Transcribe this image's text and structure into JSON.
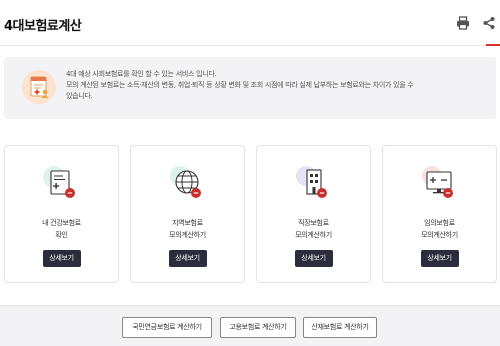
{
  "header": {
    "title": "4대보험료계산",
    "print_icon": "print-icon",
    "share_icon": "share-icon",
    "accent_color": "#d6332f"
  },
  "notice": {
    "icon": "document-person-icon",
    "lines": [
      "4대 예상 사회보험료를 확인 할 수 있는 서비스 입니다.",
      "모의 계산된 보험료는 소득·재산의 변동, 취업·퇴직 등 상황 변화 및 조회 시점에 따라 실제 납부하는 보험료와는 차이가 있을 수",
      "있습니다."
    ]
  },
  "cards": [
    {
      "line1": "내 건강보험료",
      "line2": "확인",
      "button": "상세보기",
      "icon": "health-document-icon"
    },
    {
      "line1": "지역보험료",
      "line2": "모의계산하기",
      "button": "상세보기",
      "icon": "globe-icon"
    },
    {
      "line1": "직장보험료",
      "line2": "모의계산하기",
      "button": "상세보기",
      "icon": "building-icon"
    },
    {
      "line1": "임의보험료",
      "line2": "모의계산하기",
      "button": "상세보기",
      "icon": "monitor-calculator-icon"
    }
  ],
  "links": [
    {
      "label": "국민연금보험료 계산하기"
    },
    {
      "label": "고용보험료 계산하기"
    },
    {
      "label": "산재보험료 계산하기"
    }
  ]
}
